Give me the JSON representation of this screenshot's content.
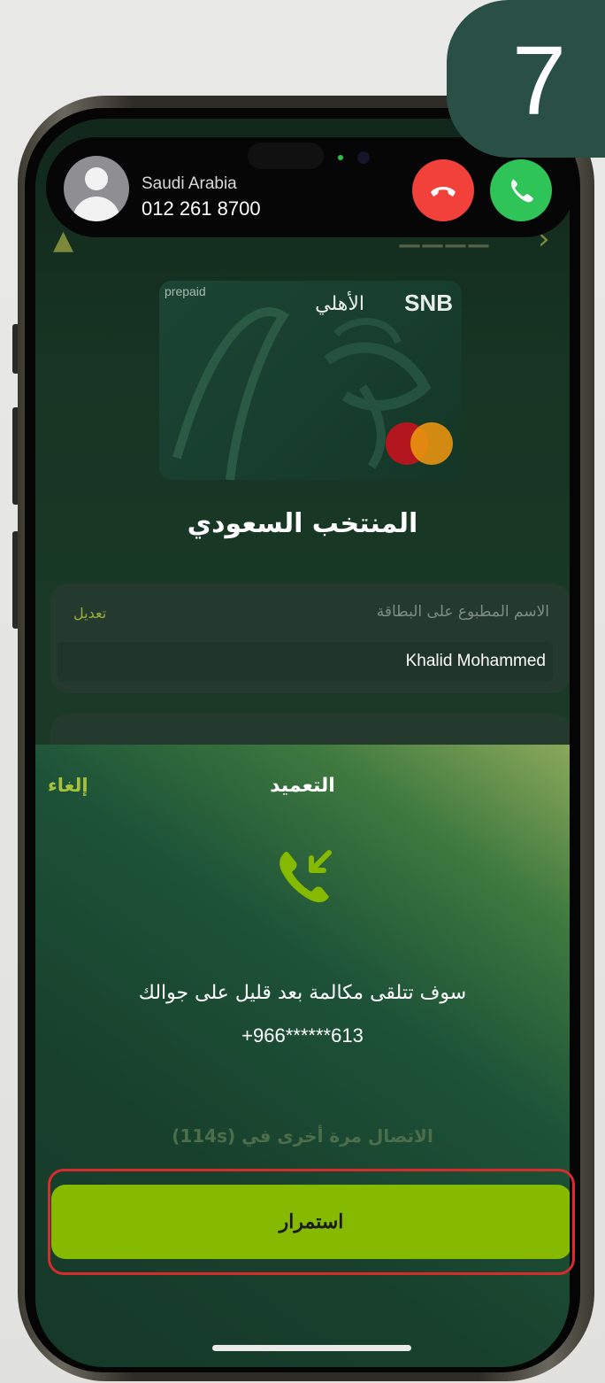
{
  "step": {
    "number": "7"
  },
  "incoming_call": {
    "region": "Saudi Arabia",
    "number": "012 261 8700",
    "decline_icon": "phone-hangup-icon",
    "accept_icon": "phone-icon"
  },
  "card": {
    "type_label": "prepaid",
    "bank_latin": "SNB",
    "bank_arabic": "الأهلي",
    "network_icon": "mastercard-icon",
    "name": "المنتخب السعودي"
  },
  "printed_name_field": {
    "label": "الاسم المطبوع على البطاقة",
    "edit_label": "تعديل",
    "value": "Khalid Mohammed"
  },
  "sheet": {
    "title": "التعميد",
    "cancel_label": "إلغاء",
    "icon": "incoming-call-icon",
    "message": "سوف تتلقى مكالمة بعد قليل على جوالك",
    "masked_phone": "+966******613",
    "retry_text": "الاتصال مرة أخرى في (114s)",
    "continue_label": "استمرار"
  },
  "colors": {
    "accent": "#86ba00",
    "badge": "#2a4f45",
    "highlight": "#d82b2b",
    "decline": "#f2403a",
    "accept": "#2fc457"
  }
}
